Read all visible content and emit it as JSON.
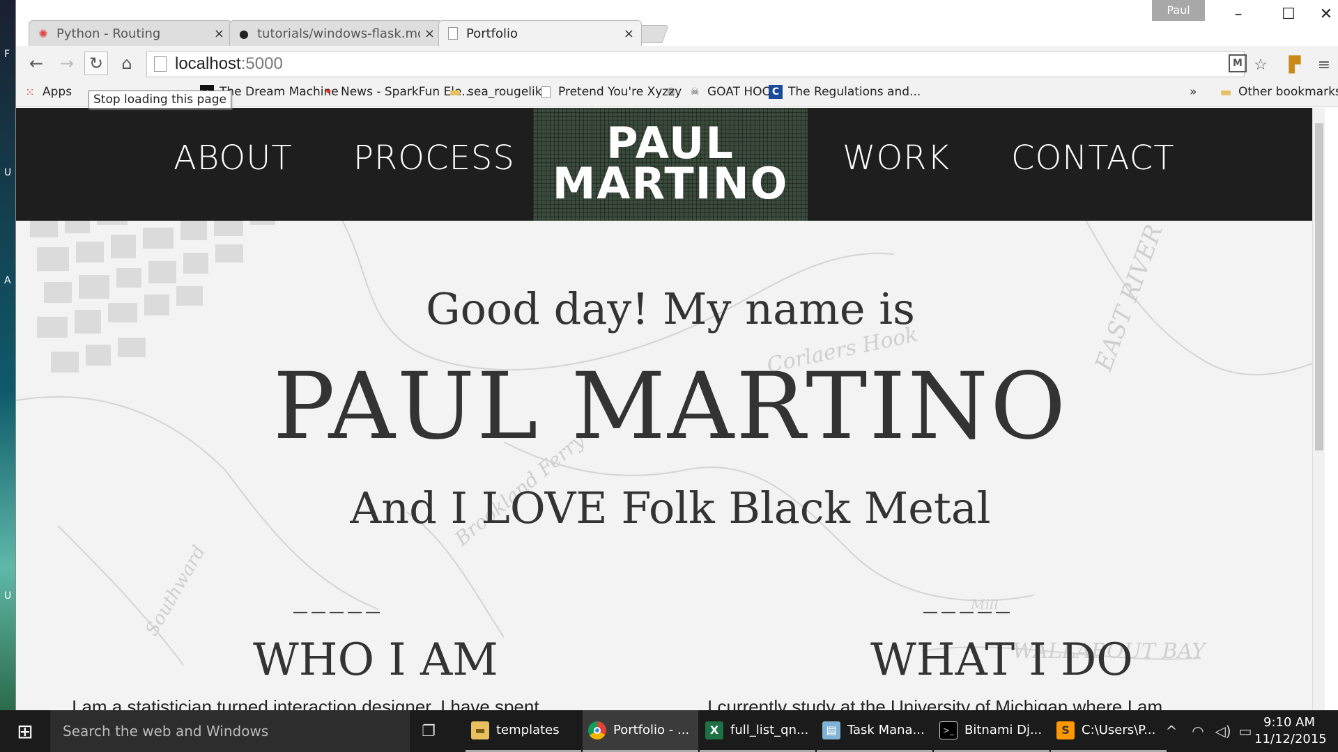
{
  "browser": {
    "user_badge": "Paul",
    "tabs": [
      {
        "title": "Python - Routing",
        "icon": "python-favicon",
        "close": "×"
      },
      {
        "title": "tutorials/windows-flask.md",
        "icon": "github-favicon",
        "close": "×"
      },
      {
        "title": "Portfolio",
        "icon": "page-favicon",
        "close": "×"
      }
    ],
    "window_controls": {
      "minimize": "–",
      "maximize": "☐",
      "close": "✕"
    },
    "address": {
      "host": "localhost",
      "port": ":5000"
    },
    "tooltip": "Stop loading this page",
    "bookmarks": [
      {
        "label": "Apps",
        "icon": "apps-grid-icon"
      },
      {
        "label": "The Dream Machine",
        "icon": "dream-machine-favicon"
      },
      {
        "label": "News - SparkFun Ele...",
        "icon": "sparkfun-favicon"
      },
      {
        "label": "sea_rougelike",
        "icon": "folder-icon"
      },
      {
        "label": "Pretend You're Xyzzy",
        "icon": "page-icon"
      },
      {
        "label": "",
        "icon": "skull-favicon"
      },
      {
        "label": "GOAT HOOF",
        "icon": "skull-favicon"
      },
      {
        "label": "The Regulations and...",
        "icon": "c-favicon"
      }
    ],
    "bookmarks_overflow": "»",
    "other_bookmarks": "Other bookmarks"
  },
  "site": {
    "nav": {
      "about": "ABOUT",
      "process": "PROCESS",
      "work": "WORK",
      "contact": "CONTACT"
    },
    "logo": {
      "line1": "PAUL",
      "line2": "MARTINO"
    },
    "hero": {
      "greeting": "Good day! My name is",
      "name": "PAUL MARTINO",
      "tagline": "And I LOVE Folk Black Metal"
    },
    "sections": [
      {
        "divider": "_____",
        "title": "WHO I AM",
        "body": "I am a statistician turned interaction designer. I have spent"
      },
      {
        "divider": "_____",
        "title": "WHAT I DO",
        "body": "I currently study at the University of Michigan where I am"
      }
    ]
  },
  "taskbar": {
    "search_placeholder": "Search the web and Windows",
    "items": [
      {
        "label": "templates",
        "icon": "folder-icon"
      },
      {
        "label": "Portfolio - ...",
        "icon": "chrome-icon"
      },
      {
        "label": "full_list_qn...",
        "icon": "excel-icon"
      },
      {
        "label": "Task Mana...",
        "icon": "task-manager-icon"
      },
      {
        "label": "Bitnami Dj...",
        "icon": "terminal-icon"
      },
      {
        "label": "C:\\Users\\P...",
        "icon": "sublime-icon"
      }
    ],
    "time": "9:10 AM",
    "date": "11/12/2015"
  }
}
